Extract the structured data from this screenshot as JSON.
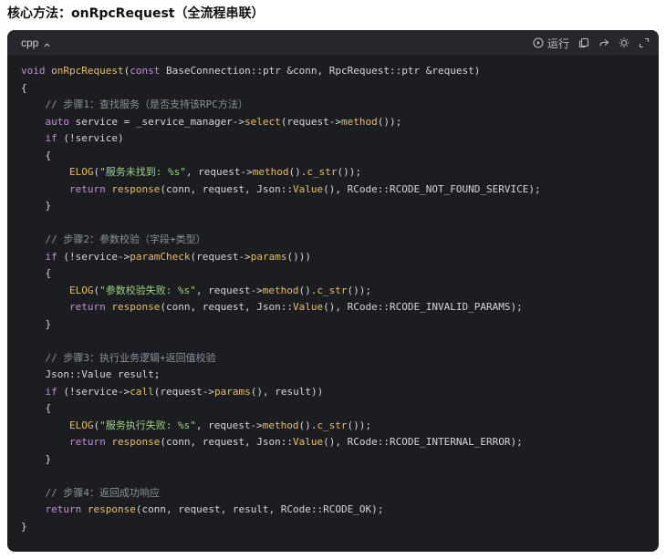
{
  "heading": "核心方法：onRpcRequest（全流程串联）",
  "code_block": {
    "language": "cpp",
    "run_label": "运行",
    "icons": [
      "chevron-up-icon",
      "play-circle-icon",
      "copy-icon",
      "share-icon",
      "theme-toggle-icon",
      "expand-icon"
    ],
    "lines": [
      [
        [
          "kw",
          "void"
        ],
        [
          "txt",
          " "
        ],
        [
          "fn",
          "onRpcRequest"
        ],
        [
          "txt",
          "("
        ],
        [
          "kw",
          "const"
        ],
        [
          "txt",
          " BaseConnection::ptr &conn, RpcRequest::ptr &request)"
        ]
      ],
      [
        [
          "txt",
          "{"
        ]
      ],
      [
        [
          "cm",
          "    // 步骤1：查找服务（是否支持该RPC方法）"
        ]
      ],
      [
        [
          "txt",
          "    "
        ],
        [
          "kw",
          "auto"
        ],
        [
          "txt",
          " service = _service_manager->"
        ],
        [
          "fn",
          "select"
        ],
        [
          "txt",
          "(request->"
        ],
        [
          "fn",
          "method"
        ],
        [
          "txt",
          "());"
        ]
      ],
      [
        [
          "txt",
          "    "
        ],
        [
          "kw",
          "if"
        ],
        [
          "txt",
          " (!service)"
        ]
      ],
      [
        [
          "txt",
          "    {"
        ]
      ],
      [
        [
          "txt",
          "        "
        ],
        [
          "fn",
          "ELOG"
        ],
        [
          "txt",
          "("
        ],
        [
          "str",
          "\"服务未找到: %s\""
        ],
        [
          "txt",
          ", request->"
        ],
        [
          "fn",
          "method"
        ],
        [
          "txt",
          "()."
        ],
        [
          "fn",
          "c_str"
        ],
        [
          "txt",
          "());"
        ]
      ],
      [
        [
          "txt",
          "        "
        ],
        [
          "kw",
          "return"
        ],
        [
          "txt",
          " "
        ],
        [
          "fn",
          "response"
        ],
        [
          "txt",
          "(conn, request, Json::"
        ],
        [
          "fn",
          "Value"
        ],
        [
          "txt",
          "(), RCode::RCODE_NOT_FOUND_SERVICE);"
        ]
      ],
      [
        [
          "txt",
          "    }"
        ]
      ],
      [
        [
          "txt",
          ""
        ]
      ],
      [
        [
          "cm",
          "    // 步骤2：参数校验（字段+类型）"
        ]
      ],
      [
        [
          "txt",
          "    "
        ],
        [
          "kw",
          "if"
        ],
        [
          "txt",
          " (!service->"
        ],
        [
          "fn",
          "paramCheck"
        ],
        [
          "txt",
          "(request->"
        ],
        [
          "fn",
          "params"
        ],
        [
          "txt",
          "()))"
        ]
      ],
      [
        [
          "txt",
          "    {"
        ]
      ],
      [
        [
          "txt",
          "        "
        ],
        [
          "fn",
          "ELOG"
        ],
        [
          "txt",
          "("
        ],
        [
          "str",
          "\"参数校验失败: %s\""
        ],
        [
          "txt",
          ", request->"
        ],
        [
          "fn",
          "method"
        ],
        [
          "txt",
          "()."
        ],
        [
          "fn",
          "c_str"
        ],
        [
          "txt",
          "());"
        ]
      ],
      [
        [
          "txt",
          "        "
        ],
        [
          "kw",
          "return"
        ],
        [
          "txt",
          " "
        ],
        [
          "fn",
          "response"
        ],
        [
          "txt",
          "(conn, request, Json::"
        ],
        [
          "fn",
          "Value"
        ],
        [
          "txt",
          "(), RCode::RCODE_INVALID_PARAMS);"
        ]
      ],
      [
        [
          "txt",
          "    }"
        ]
      ],
      [
        [
          "txt",
          ""
        ]
      ],
      [
        [
          "cm",
          "    // 步骤3：执行业务逻辑+返回值校验"
        ]
      ],
      [
        [
          "txt",
          "    Json::Value result;"
        ]
      ],
      [
        [
          "txt",
          "    "
        ],
        [
          "kw",
          "if"
        ],
        [
          "txt",
          " (!service->"
        ],
        [
          "fn",
          "call"
        ],
        [
          "txt",
          "(request->"
        ],
        [
          "fn",
          "params"
        ],
        [
          "txt",
          "(), result))"
        ]
      ],
      [
        [
          "txt",
          "    {"
        ]
      ],
      [
        [
          "txt",
          "        "
        ],
        [
          "fn",
          "ELOG"
        ],
        [
          "txt",
          "("
        ],
        [
          "str",
          "\"服务执行失败: %s\""
        ],
        [
          "txt",
          ", request->"
        ],
        [
          "fn",
          "method"
        ],
        [
          "txt",
          "()."
        ],
        [
          "fn",
          "c_str"
        ],
        [
          "txt",
          "());"
        ]
      ],
      [
        [
          "txt",
          "        "
        ],
        [
          "kw",
          "return"
        ],
        [
          "txt",
          " "
        ],
        [
          "fn",
          "response"
        ],
        [
          "txt",
          "(conn, request, Json::"
        ],
        [
          "fn",
          "Value"
        ],
        [
          "txt",
          "(), RCode::RCODE_INTERNAL_ERROR);"
        ]
      ],
      [
        [
          "txt",
          "    }"
        ]
      ],
      [
        [
          "txt",
          ""
        ]
      ],
      [
        [
          "cm",
          "    // 步骤4：返回成功响应"
        ]
      ],
      [
        [
          "txt",
          "    "
        ],
        [
          "kw",
          "return"
        ],
        [
          "txt",
          " "
        ],
        [
          "fn",
          "response"
        ],
        [
          "txt",
          "(conn, request, result, RCode::RCODE_OK);"
        ]
      ],
      [
        [
          "txt",
          "}"
        ]
      ]
    ]
  }
}
